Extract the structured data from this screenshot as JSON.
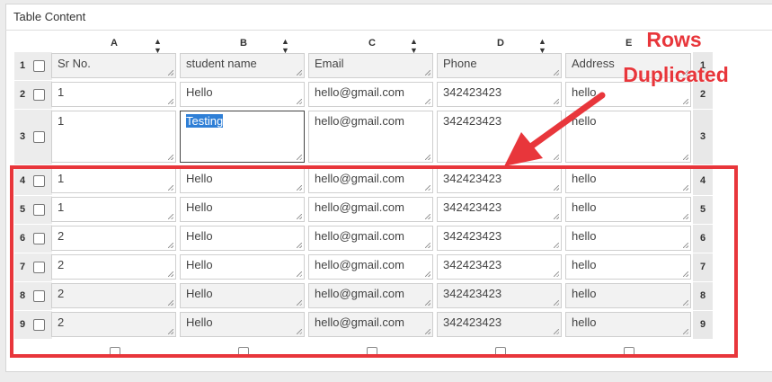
{
  "panel": {
    "title": "Table Content"
  },
  "columns": [
    {
      "letter": "A",
      "sort": "▲ ▼"
    },
    {
      "letter": "B",
      "sort": "▲ ▼"
    },
    {
      "letter": "C",
      "sort": "▲ ▼"
    },
    {
      "letter": "D",
      "sort": "▲ ▼"
    },
    {
      "letter": "E",
      "sort": ""
    }
  ],
  "rows": [
    {
      "num": "1",
      "cells": [
        "Sr No.",
        "student name",
        "Email",
        "Phone",
        "Address"
      ]
    },
    {
      "num": "2",
      "cells": [
        "1",
        "Hello",
        "hello@gmail.com",
        "342423423",
        "hello"
      ]
    },
    {
      "num": "3",
      "cells": [
        "1",
        "Testing",
        "hello@gmail.com",
        "342423423",
        "hello"
      ]
    },
    {
      "num": "4",
      "cells": [
        "1",
        "Hello",
        "hello@gmail.com",
        "342423423",
        "hello"
      ]
    },
    {
      "num": "5",
      "cells": [
        "1",
        "Hello",
        "hello@gmail.com",
        "342423423",
        "hello"
      ]
    },
    {
      "num": "6",
      "cells": [
        "2",
        "Hello",
        "hello@gmail.com",
        "342423423",
        "hello"
      ]
    },
    {
      "num": "7",
      "cells": [
        "2",
        "Hello",
        "hello@gmail.com",
        "342423423",
        "hello"
      ]
    },
    {
      "num": "8",
      "cells": [
        "2",
        "Hello",
        "hello@gmail.com",
        "342423423",
        "hello"
      ]
    },
    {
      "num": "9",
      "cells": [
        "2",
        "Hello",
        "hello@gmail.com",
        "342423423",
        "hello"
      ]
    }
  ],
  "annotation": {
    "line1": "Rows",
    "line2": "Duplicated",
    "color": "#e8363b"
  },
  "selection": {
    "color": "#2f7fd6"
  }
}
